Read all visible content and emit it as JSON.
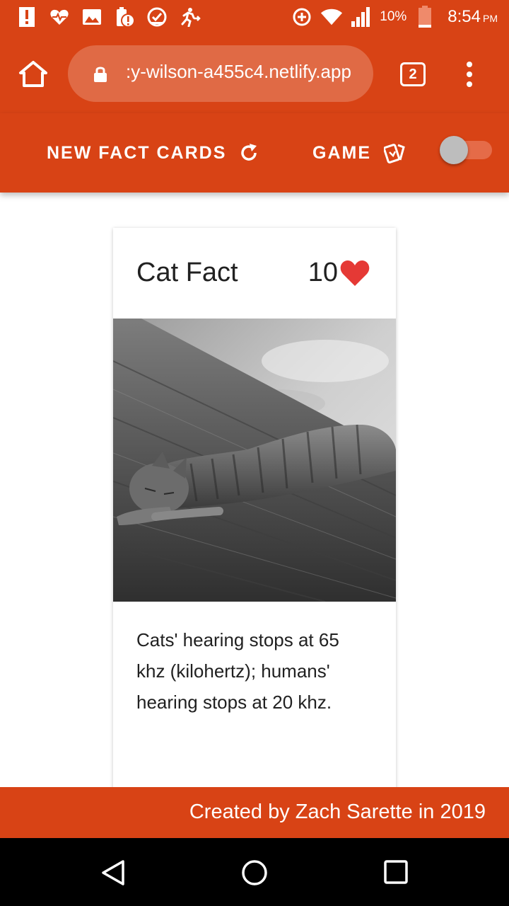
{
  "status_bar": {
    "battery_percent": "10%",
    "time": "8:54",
    "time_suffix": "PM",
    "left_icons": [
      "alert-icon",
      "heart-monitor-icon",
      "image-icon",
      "battery-alert-icon",
      "check-circle-icon",
      "running-person-icon"
    ],
    "right_icons": [
      "data-saver-icon",
      "wifi-icon",
      "signal-icon",
      "battery-icon"
    ]
  },
  "browser": {
    "url": ":y-wilson-a455c4.netlify.app",
    "tab_count": "2"
  },
  "app_bar": {
    "new_cards_label": "NEW FACT CARDS",
    "game_label": "GAME",
    "toggle_on": false
  },
  "card": {
    "title": "Cat Fact",
    "likes": "10",
    "image_subject": "grayscale photo of a kitten sleeping stretched out on a wooden deck",
    "fact": "Cats' hearing stops at 65 khz (kilohertz); humans' hearing stops at 20 khz."
  },
  "footer": {
    "text": "Created by Zach Sarette in 2019"
  },
  "colors": {
    "primary": "#d84315",
    "url_pill": "#e06a45",
    "heart": "#e53935",
    "text": "#212121"
  }
}
